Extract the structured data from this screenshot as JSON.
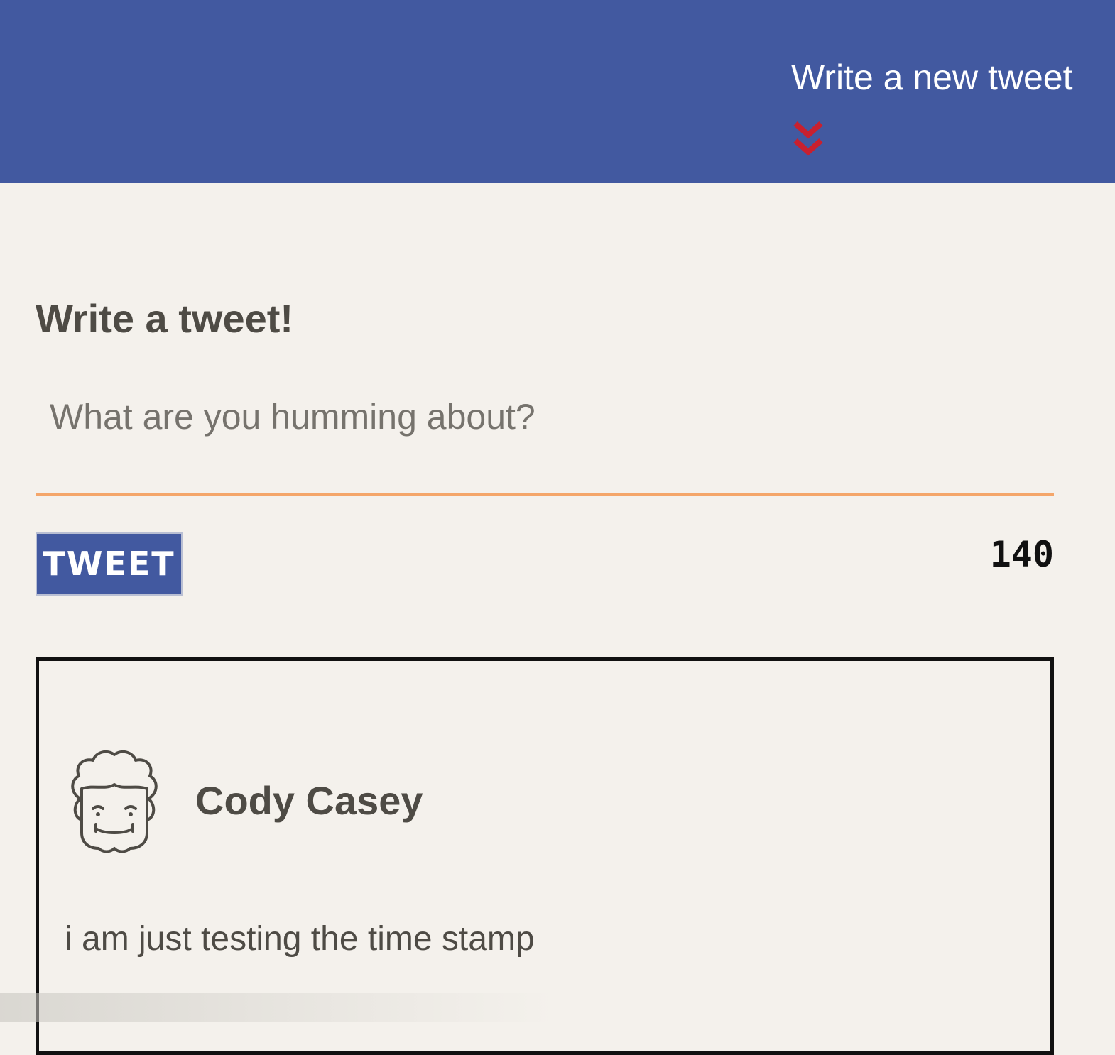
{
  "nav": {
    "compose_toggle_label": "Write a new tweet",
    "toggle_icon": "double-chevron-down-icon",
    "toggle_icon_color": "#c8202f",
    "bar_color": "#4259a0"
  },
  "compose": {
    "heading": "Write a tweet!",
    "input_placeholder": "What are you humming about?",
    "input_value": "",
    "submit_label": "TWEET",
    "char_counter": "140",
    "underline_color": "#f4a66a"
  },
  "tweets": [
    {
      "author": "Cody Casey",
      "avatar_icon": "cartoon-face-avatar-icon",
      "content": "i am just testing the time stamp"
    }
  ]
}
